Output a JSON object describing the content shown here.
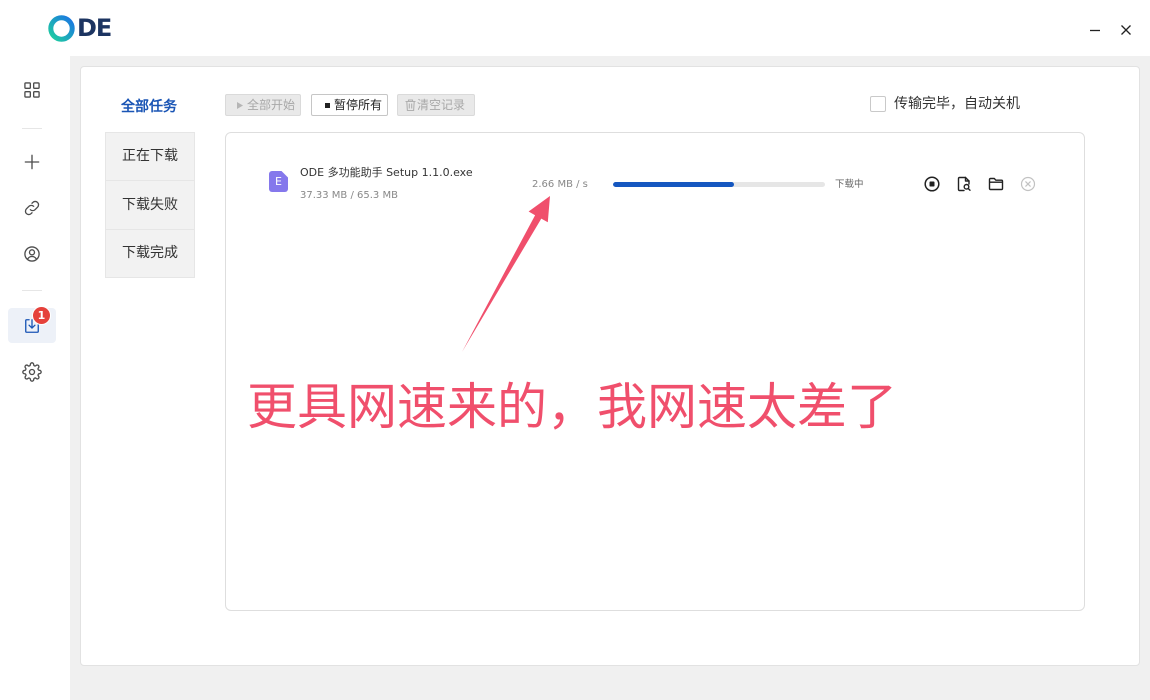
{
  "app": {
    "logo": {
      "mark": "O",
      "text": "DE"
    }
  },
  "window_controls": {
    "minimize_icon": "minimize-icon",
    "close_icon": "close-icon"
  },
  "sidebar": {
    "items": [
      {
        "icon": "grid-icon",
        "active": false
      },
      {
        "icon": "plus-icon",
        "active": false
      },
      {
        "icon": "link-icon",
        "active": false
      },
      {
        "icon": "user-circle-icon",
        "active": false
      },
      {
        "icon": "download-icon",
        "active": true,
        "badge": "1"
      },
      {
        "icon": "gear-icon",
        "active": false
      }
    ]
  },
  "tabs": [
    {
      "label": "全部任务",
      "active": true
    },
    {
      "label": "正在下载",
      "active": false
    },
    {
      "label": "下载失败",
      "active": false
    },
    {
      "label": "下载完成",
      "active": false
    }
  ],
  "toolbar": {
    "start_all": {
      "label": "全部开始",
      "icon": "play-icon",
      "enabled": false
    },
    "pause_all": {
      "label": "暂停所有",
      "icon": "stop-square-icon",
      "enabled": true
    },
    "clear_records": {
      "label": "清空记录",
      "icon": "trash-icon",
      "enabled": false
    },
    "auto_shutdown": {
      "label": "传输完毕，自动关机",
      "checked": false
    }
  },
  "tasks": [
    {
      "file_type_letter": "E",
      "name": "ODE 多功能助手 Setup 1.1.0.exe",
      "size": "37.33 MB / 65.3 MB",
      "speed": "2.66 MB / s",
      "progress": 0.57,
      "status": "下载中",
      "actions": [
        "stop-circle-icon",
        "file-search-icon",
        "folder-icon",
        "close-circle-icon"
      ]
    }
  ],
  "annotation": {
    "text": "更具网速来的，我网速太差了"
  },
  "theme": {
    "accent": "#1a55b5",
    "progress_fill": "#1557c0",
    "progress_track": "#e6e6e6",
    "badge": "#e5413b",
    "annotation": "#f04f6c",
    "file_icon": "#8578ec",
    "logo_text": "#1c3461",
    "logo_ring_start": "#1fcf9f",
    "logo_ring_end": "#1b74e4"
  }
}
